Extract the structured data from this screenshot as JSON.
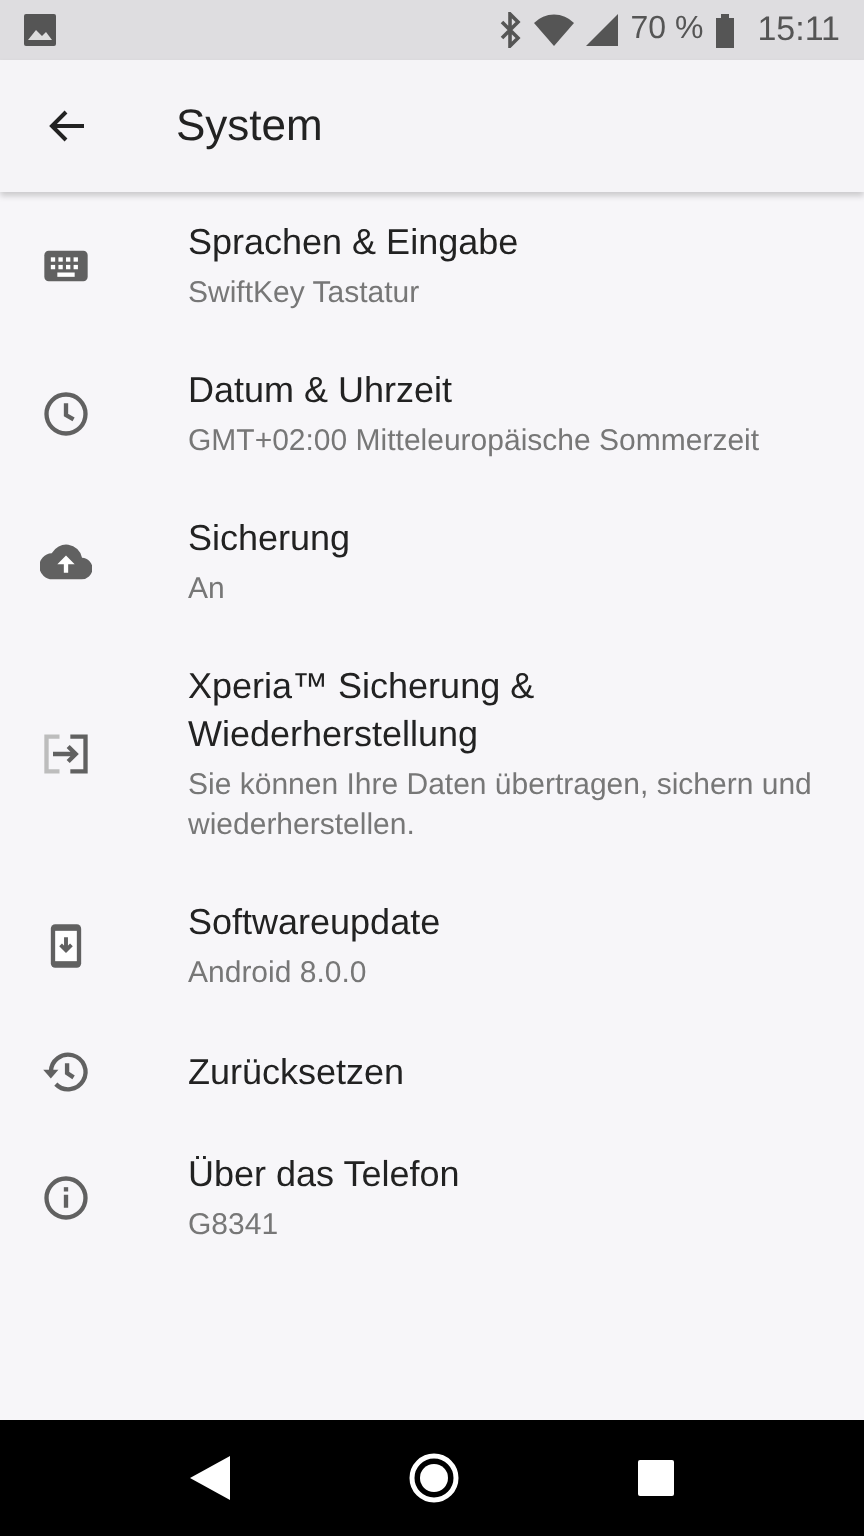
{
  "status_bar": {
    "battery": "70 %",
    "time": "15:11"
  },
  "app_bar": {
    "title": "System"
  },
  "items": [
    {
      "kind": "keyboard",
      "title": "Sprachen & Eingabe",
      "summary": "SwiftKey Tastatur"
    },
    {
      "kind": "clock",
      "title": "Datum & Uhrzeit",
      "summary": "GMT+02:00 Mitteleuropäische Sommerzeit"
    },
    {
      "kind": "cloud-upload",
      "title": "Sicherung",
      "summary": "An"
    },
    {
      "kind": "transfer",
      "title": "Xperia™ Sicherung & Wiederherstellung",
      "summary": "Sie können Ihre Daten übertragen, sichern und wiederherstellen."
    },
    {
      "kind": "phone-download",
      "title": "Softwareupdate",
      "summary": "Android 8.0.0"
    },
    {
      "kind": "history",
      "title": "Zurücksetzen"
    },
    {
      "kind": "info",
      "title": "Über das Telefon",
      "summary": "G8341"
    }
  ]
}
